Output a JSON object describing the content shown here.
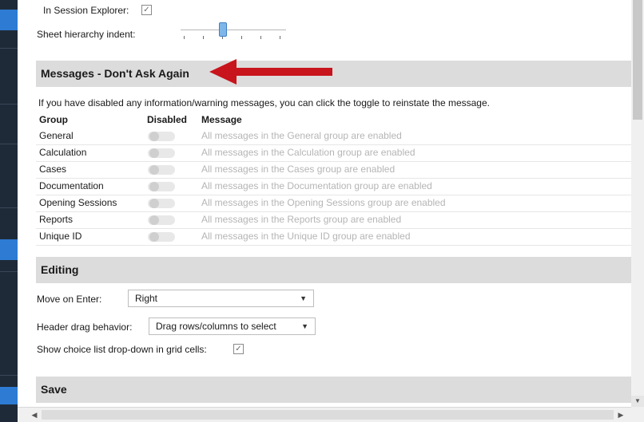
{
  "display": {
    "in_session_explorer_label": "In Session Explorer:",
    "in_session_explorer_checked": true,
    "sheet_hierarchy_indent_label": "Sheet hierarchy indent:"
  },
  "messages_section": {
    "title": "Messages - Don't Ask Again",
    "intro": "If you have disabled any information/warning messages, you can click the toggle to reinstate the message.",
    "columns": [
      "Group",
      "Disabled",
      "Message"
    ],
    "rows": [
      {
        "group": "General",
        "message": "All messages in the General group are enabled"
      },
      {
        "group": "Calculation",
        "message": "All messages in the Calculation group are enabled"
      },
      {
        "group": "Cases",
        "message": "All messages in the Cases group are enabled"
      },
      {
        "group": "Documentation",
        "message": "All messages in the Documentation group are enabled"
      },
      {
        "group": "Opening Sessions",
        "message": "All messages in the Opening Sessions group are enabled"
      },
      {
        "group": "Reports",
        "message": "All messages in the Reports group are enabled"
      },
      {
        "group": "Unique ID",
        "message": "All messages in the Unique ID group are enabled"
      }
    ]
  },
  "editing_section": {
    "title": "Editing",
    "move_on_enter_label": "Move on Enter:",
    "move_on_enter_value": "Right",
    "header_drag_label": "Header drag behavior:",
    "header_drag_value": "Drag rows/columns to select",
    "show_choice_label": "Show choice list drop-down in grid cells:",
    "show_choice_checked": true
  },
  "save_section": {
    "title": "Save"
  },
  "colors": {
    "annotation_arrow": "#c8141c",
    "section_header_bg": "#dcdcdc"
  }
}
